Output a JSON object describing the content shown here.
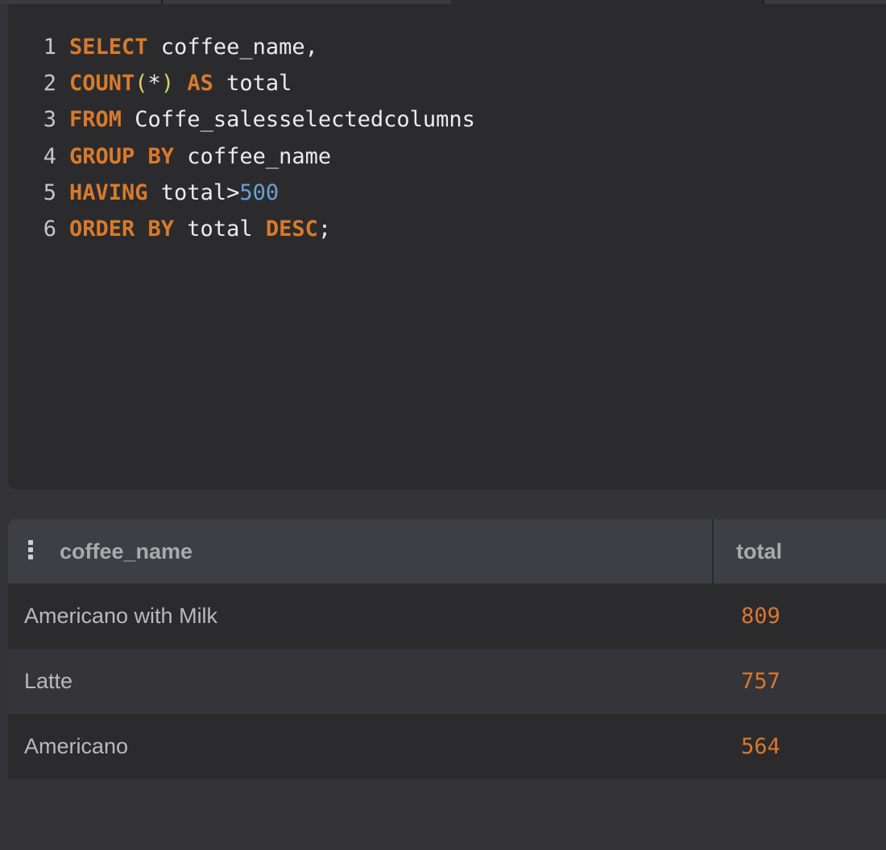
{
  "editor": {
    "lines": [
      {
        "no": "1",
        "tokens": [
          {
            "t": "SELECT",
            "k": "kw"
          },
          {
            "t": " coffee_name,",
            "k": "ident"
          }
        ]
      },
      {
        "no": "2",
        "tokens": [
          {
            "t": "COUNT",
            "k": "kw"
          },
          {
            "t": "(",
            "k": "paren"
          },
          {
            "t": "*",
            "k": "ident"
          },
          {
            "t": ")",
            "k": "paren"
          },
          {
            "t": " ",
            "k": "ident"
          },
          {
            "t": "AS",
            "k": "kw"
          },
          {
            "t": " total",
            "k": "ident"
          }
        ]
      },
      {
        "no": "3",
        "tokens": [
          {
            "t": "FROM",
            "k": "kw"
          },
          {
            "t": " Coffe_salesselectedcolumns",
            "k": "ident"
          }
        ]
      },
      {
        "no": "4",
        "tokens": [
          {
            "t": "GROUP BY",
            "k": "kw"
          },
          {
            "t": " coffee_name",
            "k": "ident"
          }
        ]
      },
      {
        "no": "5",
        "tokens": [
          {
            "t": "HAVING",
            "k": "kw"
          },
          {
            "t": " total>",
            "k": "ident"
          },
          {
            "t": "500",
            "k": "num"
          }
        ]
      },
      {
        "no": "6",
        "tokens": [
          {
            "t": "ORDER BY",
            "k": "kw"
          },
          {
            "t": " total ",
            "k": "ident"
          },
          {
            "t": "DESC",
            "k": "kw"
          },
          {
            "t": ";",
            "k": "ident"
          }
        ]
      }
    ]
  },
  "results": {
    "columns": [
      "coffee_name",
      "total"
    ],
    "rows": [
      {
        "coffee_name": "Americano with Milk",
        "total": "809"
      },
      {
        "coffee_name": "Latte",
        "total": "757"
      },
      {
        "coffee_name": "Americano",
        "total": "564"
      }
    ]
  },
  "colors": {
    "keyword": "#d97a2b",
    "number": "#6c9fd2",
    "paren": "#d8d26a",
    "total_value": "#d9772c",
    "editor_bg": "#2b2b2e",
    "panel_bg": "#343438"
  },
  "icons": {
    "column_menu": "kebab-vertical-icon"
  }
}
